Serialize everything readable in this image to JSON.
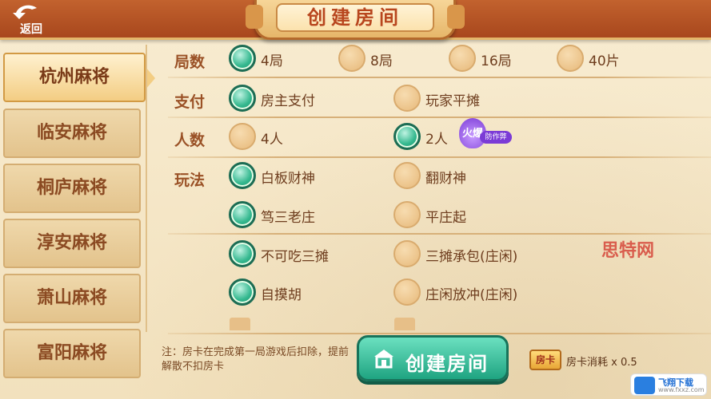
{
  "header": {
    "back_label": "返回",
    "title": "创建房间"
  },
  "sidebar": {
    "items": [
      {
        "label": "杭州麻将",
        "active": true
      },
      {
        "label": "临安麻将",
        "active": false
      },
      {
        "label": "桐庐麻将",
        "active": false
      },
      {
        "label": "淳安麻将",
        "active": false
      },
      {
        "label": "萧山麻将",
        "active": false
      },
      {
        "label": "富阳麻将",
        "active": false
      }
    ]
  },
  "options": {
    "rounds": {
      "label": "局数",
      "choices": [
        {
          "label": "4局",
          "selected": true
        },
        {
          "label": "8局",
          "selected": false
        },
        {
          "label": "16局",
          "selected": false
        },
        {
          "label": "40片",
          "selected": false
        }
      ]
    },
    "payment": {
      "label": "支付",
      "choices": [
        {
          "label": "房主支付",
          "selected": true
        },
        {
          "label": "玩家平摊",
          "selected": false
        }
      ]
    },
    "players": {
      "label": "人数",
      "choices": [
        {
          "label": "4人",
          "selected": false
        },
        {
          "label": "2人",
          "selected": true
        }
      ],
      "badge_main": "火爆",
      "badge_sub": "防作弊"
    },
    "rules": {
      "label": "玩法",
      "choices": [
        {
          "label": "白板财神",
          "selected": true
        },
        {
          "label": "翻财神",
          "selected": false
        },
        {
          "label": "笃三老庄",
          "selected": true
        },
        {
          "label": "平庄起",
          "selected": false
        },
        {
          "label": "不可吃三摊",
          "selected": true
        },
        {
          "label": "三摊承包(庄闲)",
          "selected": false
        },
        {
          "label": "自摸胡",
          "selected": true
        },
        {
          "label": "庄闲放冲(庄闲)",
          "selected": false
        }
      ]
    }
  },
  "footer": {
    "note": "注：房卡在完成第一局游戏后扣除，提前解散不扣房卡",
    "create_button": "创建房间",
    "card_icon_label": "房卡",
    "card_cost": "房卡消耗 x 0.5"
  },
  "watermark": {
    "text": "思特网",
    "logo_line1": "飞翔下载",
    "logo_line2": "www.fxxz.com"
  },
  "colors": {
    "header": "#b0501f",
    "selected_radio": "#2fb088",
    "button": "#22a583",
    "text_brown": "#6e3d1e"
  }
}
